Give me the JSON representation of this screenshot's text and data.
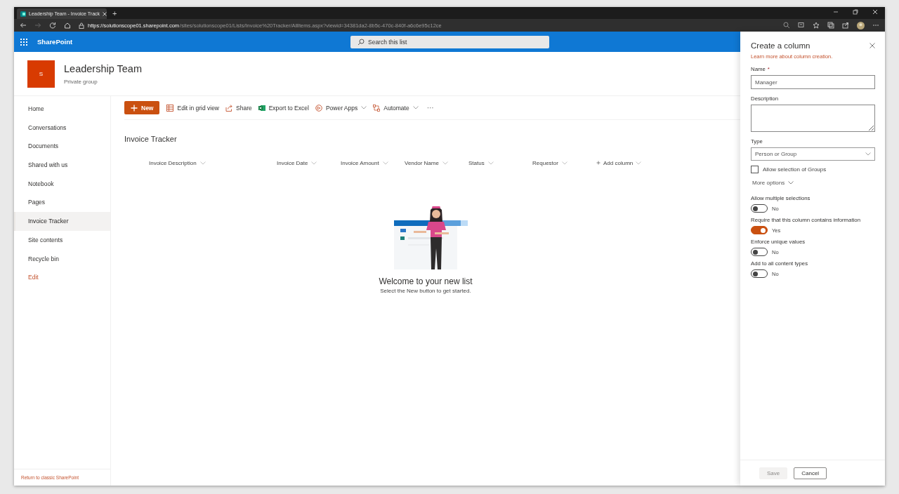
{
  "browser": {
    "tabs": [
      {
        "title": "Leadership Team - Invoice Track",
        "selected": true
      }
    ],
    "new_tab": "+",
    "url_host": "https://solutionscope01.sharepoint.com",
    "url_path": "/sites/solutionscope01/Lists/Invoice%20Tracker/AllItems.aspx?viewid=34381da2-8b5c-470c-840f-a6c6e95c12ce"
  },
  "suite_bar": {
    "app": "SharePoint",
    "search_placeholder": "Search this list"
  },
  "site": {
    "logo": "S",
    "title": "Leadership Team",
    "subtitle": "Private group"
  },
  "nav": {
    "items": [
      {
        "label": "Home",
        "selected": false,
        "kind": "link"
      },
      {
        "label": "Conversations",
        "selected": false,
        "kind": "link"
      },
      {
        "label": "Documents",
        "selected": false,
        "kind": "link"
      },
      {
        "label": "Shared with us",
        "selected": false,
        "kind": "link"
      },
      {
        "label": "Notebook",
        "selected": false,
        "kind": "link"
      },
      {
        "label": "Pages",
        "selected": false,
        "kind": "link"
      },
      {
        "label": "Invoice Tracker",
        "selected": true,
        "kind": "link"
      },
      {
        "label": "Site contents",
        "selected": false,
        "kind": "link"
      },
      {
        "label": "Recycle bin",
        "selected": false,
        "kind": "link"
      },
      {
        "label": "Edit",
        "selected": false,
        "kind": "action"
      }
    ],
    "footer": "Return to classic SharePoint"
  },
  "commands": [
    {
      "label": "New",
      "kind": "new",
      "dropdown": false
    },
    {
      "label": "Edit in grid view",
      "kind": "grid",
      "dropdown": false
    },
    {
      "label": "Share",
      "kind": "share",
      "dropdown": false
    },
    {
      "label": "Export to Excel",
      "kind": "export",
      "dropdown": false
    },
    {
      "label": "Power Apps",
      "kind": "powerapps",
      "dropdown": true
    },
    {
      "label": "Automate",
      "kind": "automate",
      "dropdown": true
    },
    {
      "label": "···",
      "kind": "more",
      "dropdown": false
    }
  ],
  "list": {
    "title": "Invoice Tracker",
    "columns": [
      {
        "label": "Invoice Description",
        "kind": "column"
      },
      {
        "label": "Invoice Date",
        "kind": "column"
      },
      {
        "label": "Invoice Amount",
        "kind": "column"
      },
      {
        "label": "Vendor Name",
        "kind": "column"
      },
      {
        "label": "Status",
        "kind": "column"
      },
      {
        "label": "Requestor",
        "kind": "column"
      },
      {
        "label": "Add column",
        "kind": "add"
      }
    ],
    "empty_title": "Welcome to your new list",
    "empty_text": "Select the New button to get started."
  },
  "panel": {
    "title": "Create a column",
    "link": "Learn more about column creation.",
    "fields": [
      {
        "kind": "text",
        "label": "Name",
        "required_mark": "*",
        "value": "Manager"
      },
      {
        "kind": "textarea",
        "label": "Description"
      },
      {
        "kind": "select",
        "label": "Type",
        "value": "Person or Group"
      },
      {
        "kind": "checkbox",
        "label": "Allow selection of Groups",
        "checked": false
      },
      {
        "kind": "expander",
        "label": "More options"
      },
      {
        "kind": "toggle",
        "label": "Allow multiple selections",
        "on": false,
        "state_text": "No"
      },
      {
        "kind": "toggle",
        "label": "Require that this column contains information",
        "on": true,
        "state_text": "Yes"
      },
      {
        "kind": "toggle",
        "label": "Enforce unique values",
        "on": false,
        "state_text": "No"
      },
      {
        "kind": "toggle",
        "label": "Add to all content types",
        "on": false,
        "state_text": "No"
      }
    ],
    "buttons": [
      {
        "label": "Save",
        "kind": "primary",
        "disabled": true
      },
      {
        "label": "Cancel",
        "kind": "default",
        "disabled": false
      }
    ]
  }
}
